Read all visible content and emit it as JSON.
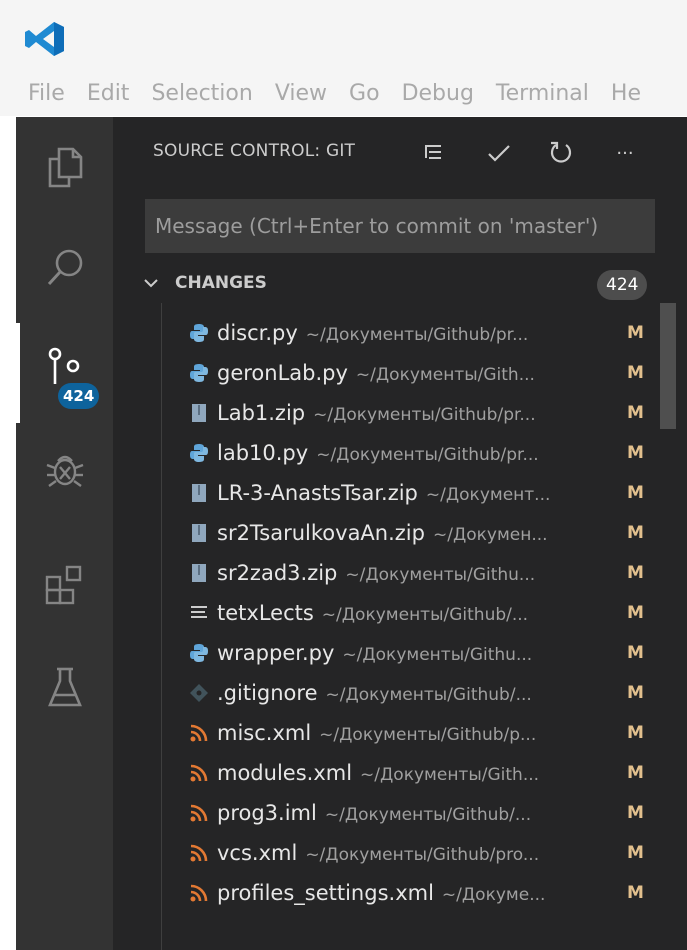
{
  "app": {
    "accent_color": "#0e639c",
    "logo_icon": "vscode-logo-icon"
  },
  "menu": {
    "items": [
      "File",
      "Edit",
      "Selection",
      "View",
      "Go",
      "Debug",
      "Terminal",
      "He"
    ]
  },
  "activity_bar": {
    "items": [
      {
        "icon": "explorer-icon"
      },
      {
        "icon": "search-icon"
      },
      {
        "icon": "source-control-icon",
        "badge": "424",
        "active": true
      },
      {
        "icon": "debug-icon"
      },
      {
        "icon": "extensions-icon"
      },
      {
        "icon": "flask-icon"
      }
    ]
  },
  "source_control": {
    "title": "SOURCE CONTROL: GIT",
    "actions": [
      "view-as-tree-icon",
      "commit-check-icon",
      "refresh-icon",
      "more-icon"
    ],
    "more_label": "···",
    "message_placeholder": "Message (Ctrl+Enter to commit on 'master')",
    "changes": {
      "title": "CHANGES",
      "count": "424",
      "files": [
        {
          "name": "discr.py",
          "path": "~/Документы/Github/pr...",
          "status": "M",
          "type": "python"
        },
        {
          "name": "geronLab.py",
          "path": "~/Документы/Gith...",
          "status": "M",
          "type": "python"
        },
        {
          "name": "Lab1.zip",
          "path": "~/Документы/Github/pr...",
          "status": "M",
          "type": "zip"
        },
        {
          "name": "lab10.py",
          "path": "~/Документы/Github/pr...",
          "status": "M",
          "type": "python"
        },
        {
          "name": "LR-3-AnastsTsar.zip",
          "path": "~/Документ...",
          "status": "M",
          "type": "zip"
        },
        {
          "name": "sr2TsarulkovaAn.zip",
          "path": "~/Докумен...",
          "status": "M",
          "type": "zip"
        },
        {
          "name": "sr2zad3.zip",
          "path": "~/Документы/Githu...",
          "status": "M",
          "type": "zip"
        },
        {
          "name": "tetxLects",
          "path": "~/Документы/Github/...",
          "status": "M",
          "type": "text"
        },
        {
          "name": "wrapper.py",
          "path": "~/Документы/Githu...",
          "status": "M",
          "type": "python"
        },
        {
          "name": ".gitignore",
          "path": "~/Документы/Github/...",
          "status": "M",
          "type": "git"
        },
        {
          "name": "misc.xml",
          "path": "~/Документы/Github/p...",
          "status": "M",
          "type": "xml"
        },
        {
          "name": "modules.xml",
          "path": "~/Документы/Gith...",
          "status": "M",
          "type": "xml"
        },
        {
          "name": "prog3.iml",
          "path": "~/Документы/Github/...",
          "status": "M",
          "type": "xml"
        },
        {
          "name": "vcs.xml",
          "path": "~/Документы/Github/pro...",
          "status": "M",
          "type": "xml"
        },
        {
          "name": "profiles_settings.xml",
          "path": "~/Докуме...",
          "status": "M",
          "type": "xml"
        }
      ]
    }
  }
}
